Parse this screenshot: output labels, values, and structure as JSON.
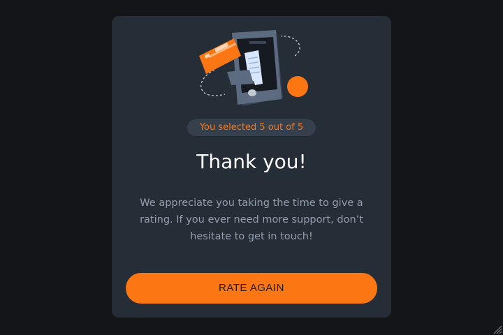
{
  "card": {
    "rating_text": "You selected 5 out of 5",
    "title": "Thank you!",
    "message": "We appreciate you taking the time to give a rating. If you ever need more support, don’t hesitate to get in touch!",
    "button_label": "RATE AGAIN"
  },
  "selected_rating": 5,
  "max_rating": 5,
  "illustration_icon": "phone-payment-receipt-icon",
  "colors": {
    "background": "#131518",
    "card": "#252d37",
    "accent": "#fc7614",
    "pill": "#363f4c",
    "title": "#ffffff",
    "text": "#959eac"
  }
}
